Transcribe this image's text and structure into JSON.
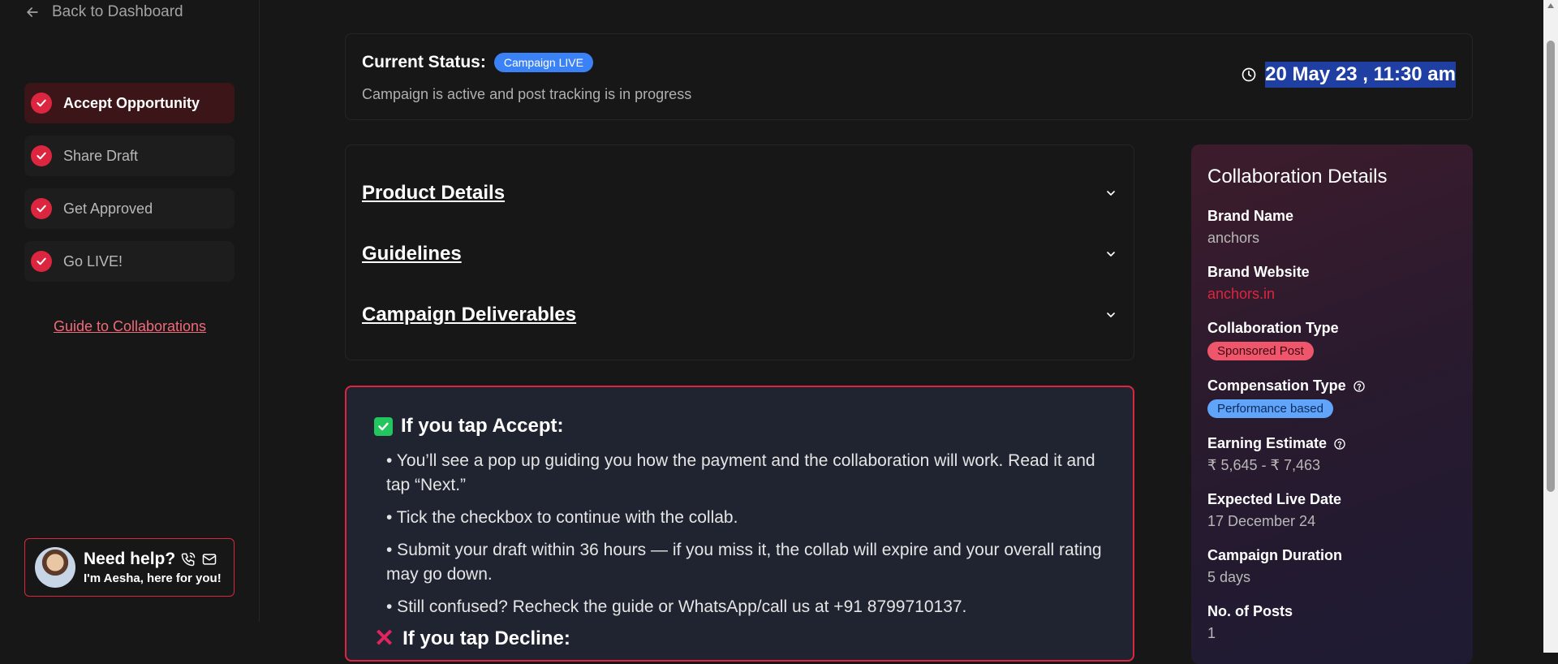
{
  "sidebar": {
    "back_label": "Back to Dashboard",
    "steps": [
      {
        "label": "Accept Opportunity",
        "active": true
      },
      {
        "label": "Share Draft",
        "active": false
      },
      {
        "label": "Get Approved",
        "active": false
      },
      {
        "label": "Go LIVE!",
        "active": false
      }
    ],
    "guide_link": "Guide to Collaborations",
    "help": {
      "title": "Need help?",
      "subtitle": "I'm Aesha, here for you!"
    }
  },
  "status": {
    "label": "Current Status:",
    "badge": "Campaign LIVE",
    "description": "Campaign is active and post tracking is in progress",
    "timestamp": "20 May 23 , 11:30 am"
  },
  "accordion": {
    "items": [
      {
        "title": "Product Details"
      },
      {
        "title": "Guidelines"
      },
      {
        "title": "Campaign Deliverables"
      }
    ]
  },
  "info": {
    "accept_heading": "If you tap Accept:",
    "bullets": [
      "• You’ll see a pop up guiding you how the payment and the collaboration will work. Read it and tap “Next.”",
      "• Tick the checkbox to continue with the collab.",
      "• Submit your draft within 36 hours — if you miss it, the collab will expire and your overall rating may go down.",
      "• Still confused? Recheck the guide or WhatsApp/call us at +91 8799710137."
    ],
    "decline_heading": "If you tap Decline:"
  },
  "collab": {
    "title": "Collaboration Details",
    "brand_name_label": "Brand Name",
    "brand_name": "anchors",
    "brand_website_label": "Brand Website",
    "brand_website": "anchors.in",
    "collab_type_label": "Collaboration Type",
    "collab_type": "Sponsored Post",
    "comp_type_label": "Compensation Type",
    "comp_type": "Performance based",
    "earning_label": "Earning Estimate",
    "earning": "₹ 5,645 - ₹ 7,463",
    "live_date_label": "Expected Live Date",
    "live_date": "17 December 24",
    "duration_label": "Campaign Duration",
    "duration": "5 days",
    "posts_label": "No. of Posts",
    "posts": "1"
  },
  "colors": {
    "accent_red": "#dc2640",
    "live_blue": "#3b82f6",
    "background": "#171717"
  }
}
